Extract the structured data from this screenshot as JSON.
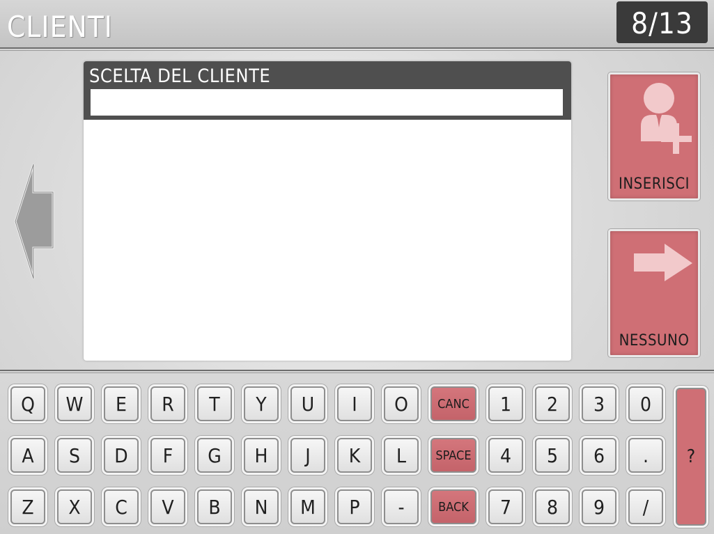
{
  "header": {
    "title": "CLIENTI",
    "step_counter": "8/13"
  },
  "client_panel": {
    "title": "SCELTA DEL CLIENTE",
    "search_value": "",
    "results": []
  },
  "nav": {
    "prev_icon": "left-arrow-icon"
  },
  "actions": {
    "insert_label": "INSERISCI",
    "insert_icon": "add-user-icon",
    "none_label": "NESSUNO",
    "none_icon": "right-arrow-icon"
  },
  "keyboard": {
    "rows": [
      [
        "Q",
        "W",
        "E",
        "R",
        "T",
        "Y",
        "U",
        "I",
        "O",
        "CANC",
        "1",
        "2",
        "3",
        "0"
      ],
      [
        "A",
        "S",
        "D",
        "F",
        "G",
        "H",
        "J",
        "K",
        "L",
        "SPACE",
        "4",
        "5",
        "6",
        "."
      ],
      [
        "Z",
        "X",
        "C",
        "V",
        "B",
        "N",
        "M",
        "P",
        "-",
        "BACK",
        "7",
        "8",
        "9",
        "/"
      ]
    ],
    "help_key": "?"
  },
  "colors": {
    "accent_red": "#cf6f75",
    "dark_bar": "#4f4f4f",
    "counter_bg": "#3a3a3a"
  }
}
